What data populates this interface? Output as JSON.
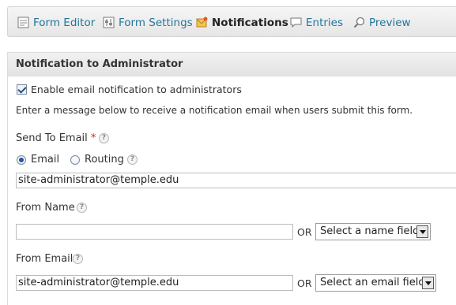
{
  "tabs": {
    "form_editor": "Form Editor",
    "form_settings": "Form Settings",
    "notifications": "Notifications",
    "entries": "Entries",
    "preview": "Preview"
  },
  "panel": {
    "title": "Notification to Administrator",
    "enable_checkbox_label": "Enable email notification to administrators",
    "enable_checked": true,
    "intro": "Enter a message below to receive a notification email when users submit this form.",
    "send_to": {
      "label": "Send To Email",
      "required_mark": "*",
      "help": "?",
      "option_email": "Email",
      "option_routing": "Routing",
      "selected": "Email",
      "value": "site-administrator@temple.edu"
    },
    "from_name": {
      "label": "From Name",
      "help": "?",
      "value": "",
      "or": "OR",
      "select_value": "Select a name field"
    },
    "from_email": {
      "label": "From Email",
      "help": "?",
      "value": "site-administrator@temple.edu",
      "or": "OR",
      "select_value": "Select an email field"
    }
  },
  "colors": {
    "link": "#21759b",
    "required": "#dd2222"
  }
}
